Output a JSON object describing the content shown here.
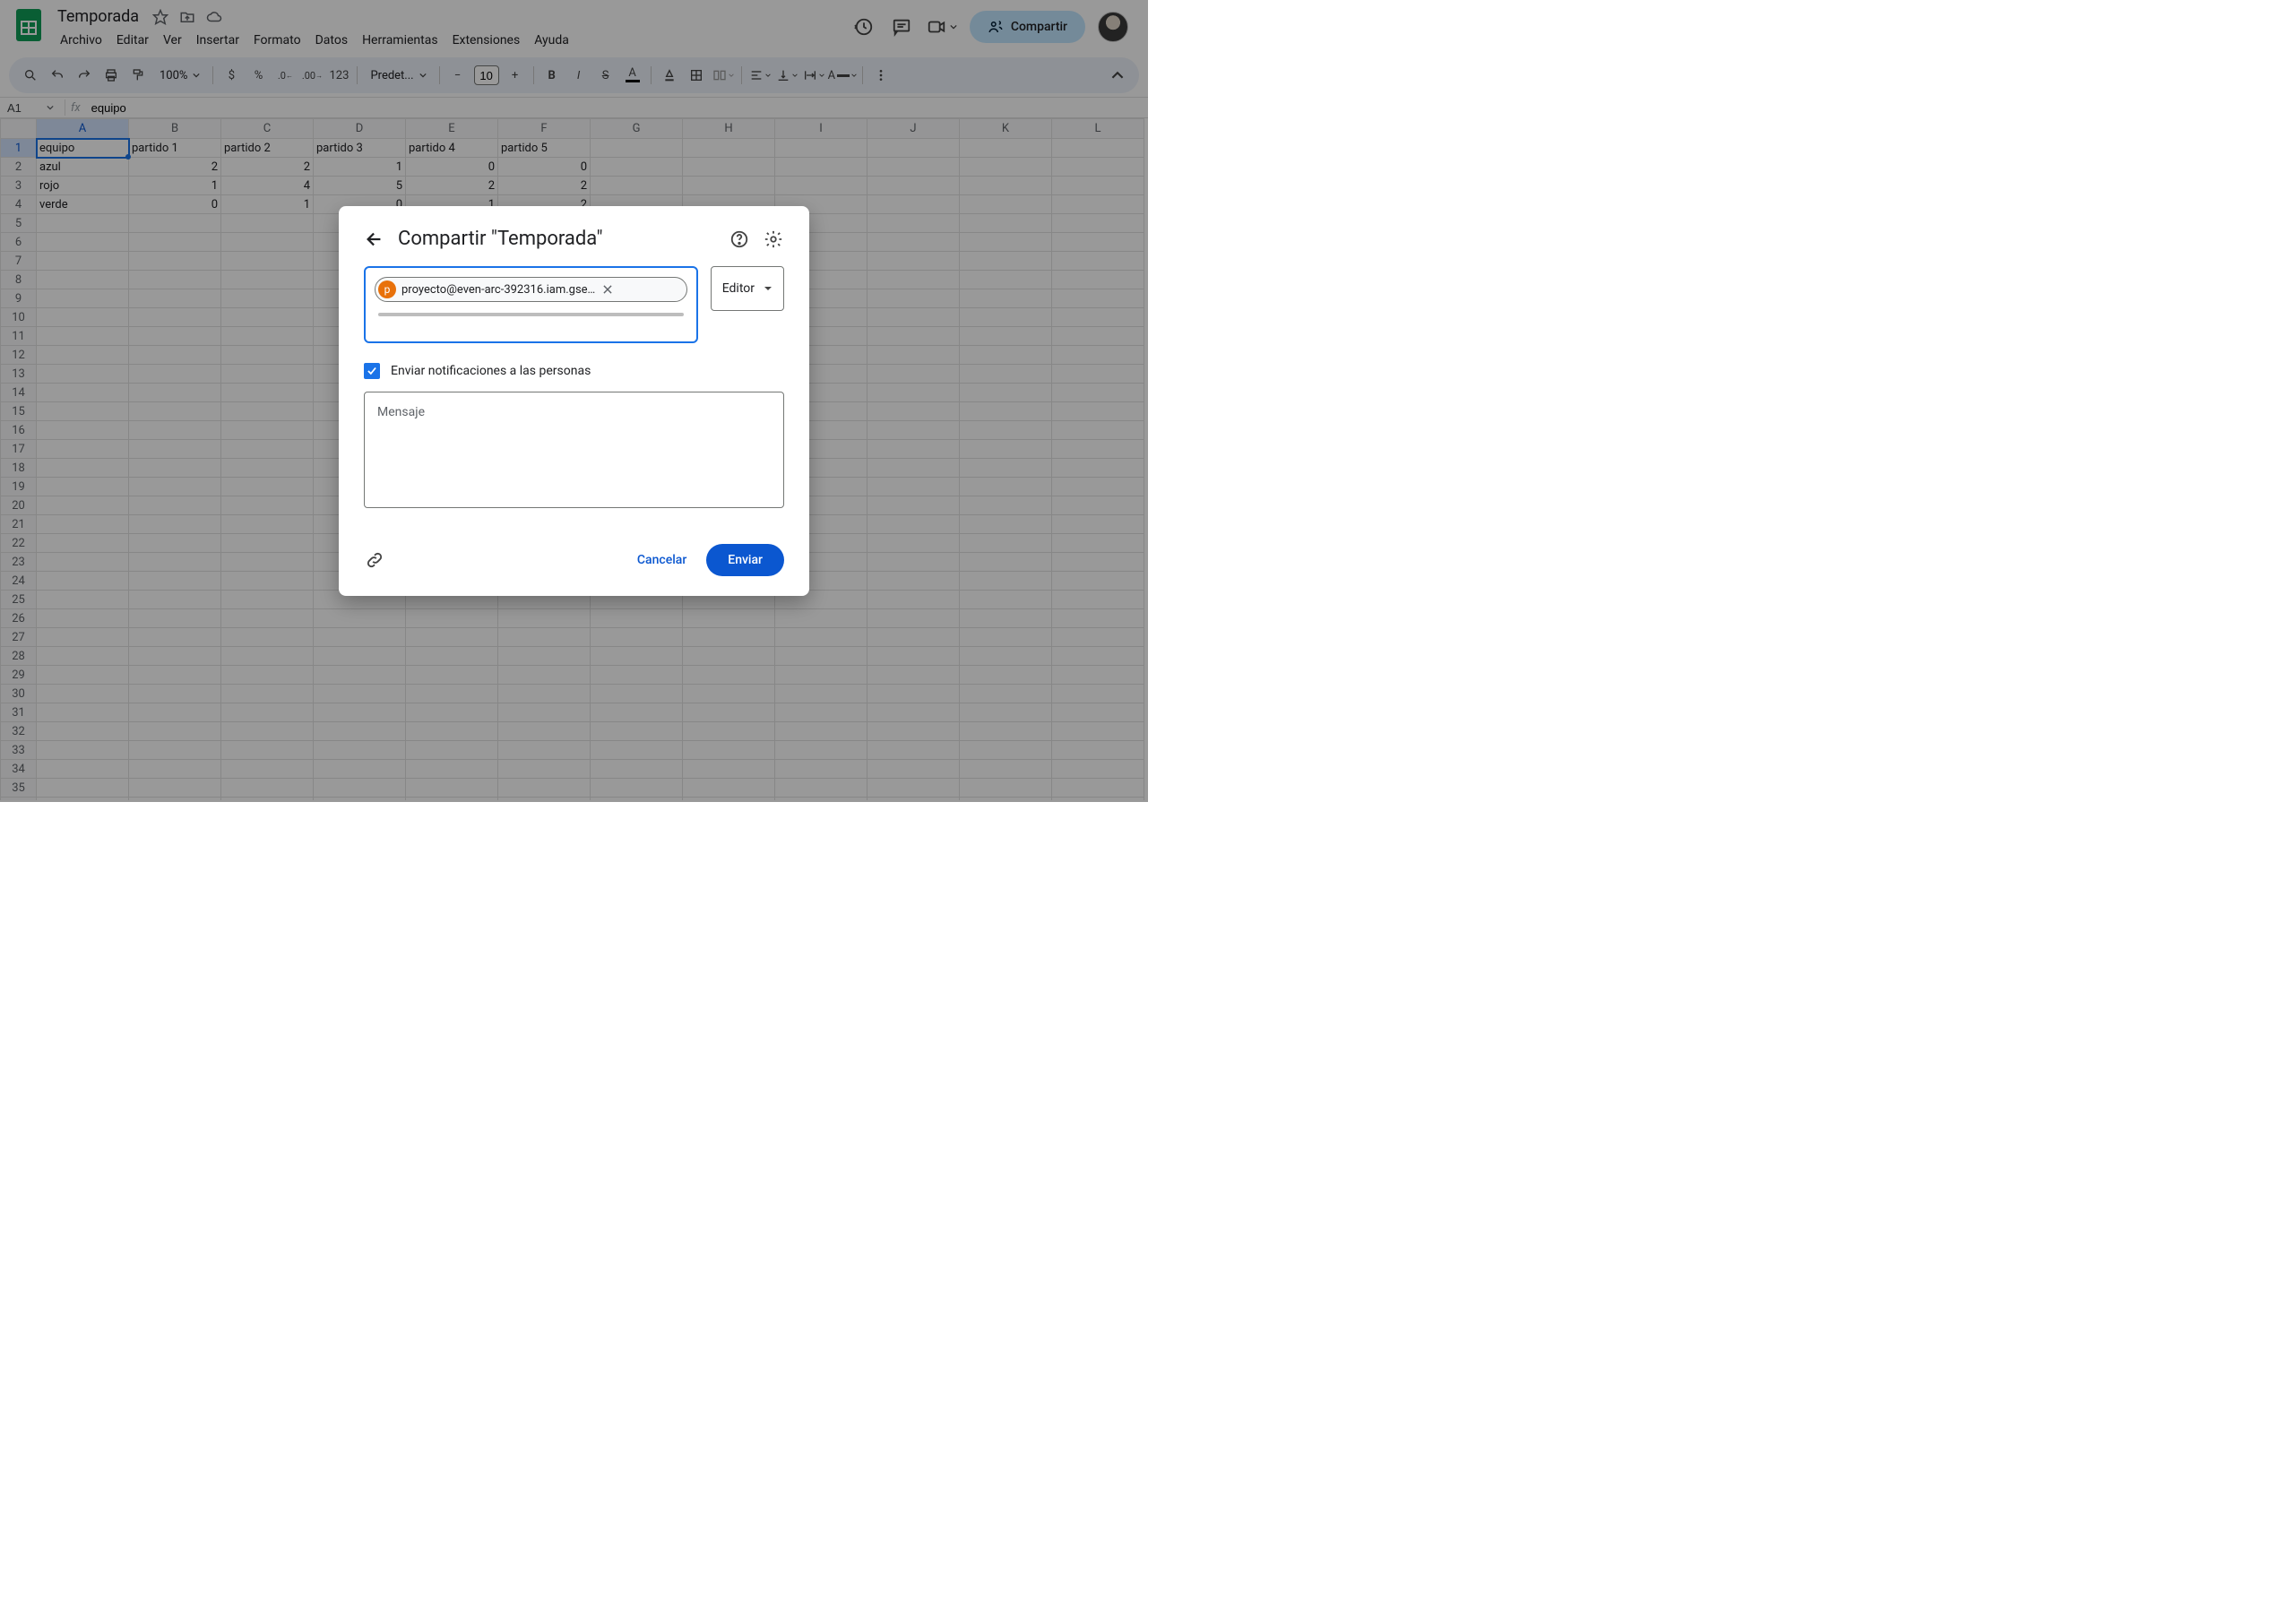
{
  "doc": {
    "title": "Temporada"
  },
  "menu": {
    "items": [
      "Archivo",
      "Editar",
      "Ver",
      "Insertar",
      "Formato",
      "Datos",
      "Herramientas",
      "Extensiones",
      "Ayuda"
    ]
  },
  "share_header_btn": "Compartir",
  "toolbar": {
    "zoom": "100%",
    "font": "Predet...",
    "fontsize": "10",
    "numberformat": "123"
  },
  "formula": {
    "cellref": "A1",
    "value": "equipo"
  },
  "columns": [
    "A",
    "B",
    "C",
    "D",
    "E",
    "F",
    "G",
    "H",
    "I",
    "J",
    "K",
    "L"
  ],
  "data_rows": [
    [
      "equipo",
      "partido 1",
      "partido 2",
      "partido 3",
      "partido 4",
      "partido 5",
      "",
      "",
      "",
      "",
      "",
      ""
    ],
    [
      "azul",
      "2",
      "2",
      "1",
      "0",
      "0",
      "",
      "",
      "",
      "",
      "",
      ""
    ],
    [
      "rojo",
      "1",
      "4",
      "5",
      "2",
      "2",
      "",
      "",
      "",
      "",
      "",
      ""
    ],
    [
      "verde",
      "0",
      "1",
      "0",
      "1",
      "2",
      "",
      "",
      "",
      "",
      "",
      ""
    ]
  ],
  "total_rows": 36,
  "dialog": {
    "title": "Compartir \"Temporada\"",
    "chip_initial": "p",
    "chip_email": "proyecto@even-arc-392316.iam.gse…",
    "role": "Editor",
    "notify_label": "Enviar notificaciones a las personas",
    "message_placeholder": "Mensaje",
    "cancel": "Cancelar",
    "send": "Enviar"
  }
}
